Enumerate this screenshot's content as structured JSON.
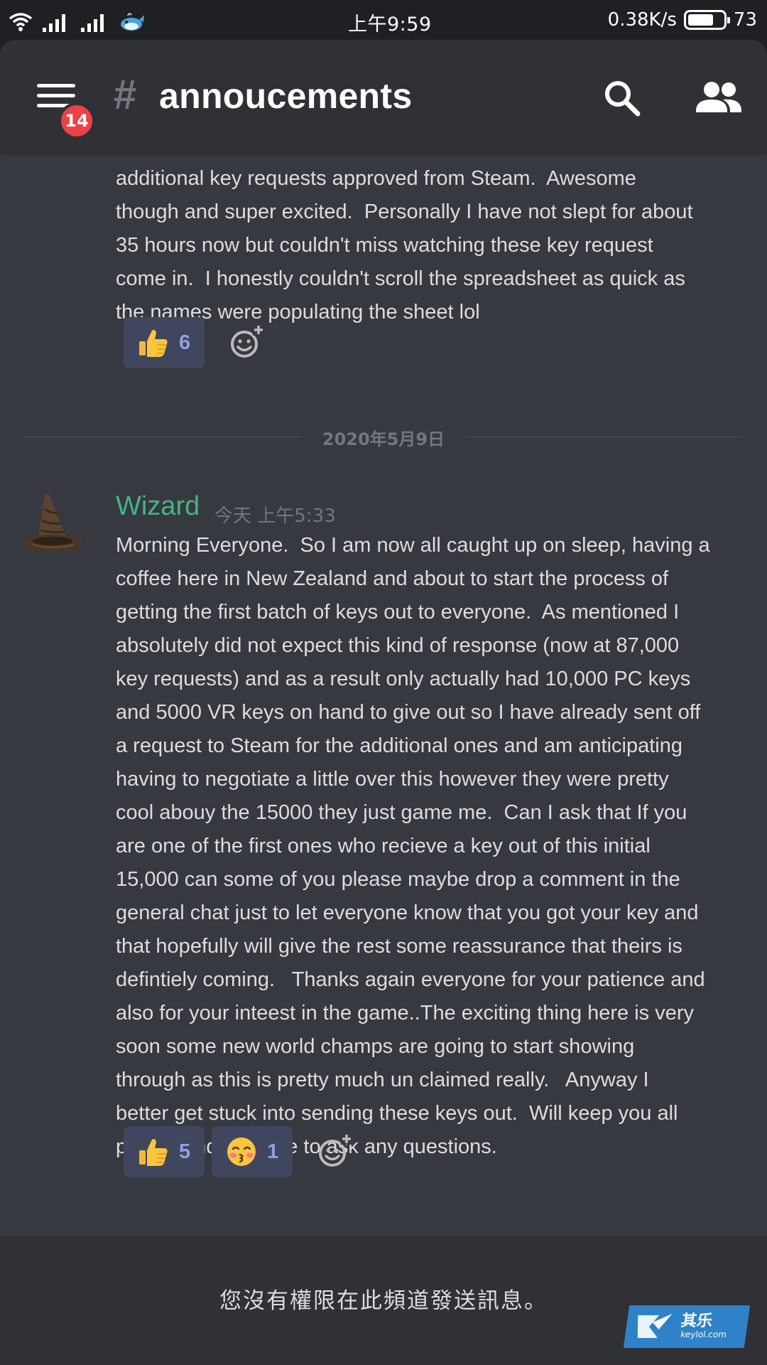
{
  "status_bar": {
    "time": "上午9:59",
    "net_speed": "0.38K/s",
    "battery_percent": "73",
    "battery_level": 0.73,
    "icons": [
      "wifi-icon",
      "signal-icon",
      "signal-icon",
      "app-icon"
    ]
  },
  "header": {
    "menu_icon": "menu-icon",
    "badge": "14",
    "hash": "#",
    "channel": "annoucements",
    "search_icon": "search-icon",
    "members_icon": "members-icon"
  },
  "message1": {
    "text": "additional key requests approved from Steam.  Awesome\nthough and super excited.  Personally I have not slept for about\n35 hours now but couldn't miss watching these key request\ncome in.  I honestly couldn't scroll the spreadsheet as quick as\nthe names were populating the sheet lol",
    "reactions": [
      {
        "emoji": "thumbs-up-emoji",
        "count": "6"
      }
    ]
  },
  "date_divider": "2020年5月9日",
  "message2": {
    "author": "Wizard",
    "timestamp": "今天 上午5:33",
    "text": "Morning Everyone.  So I am now all caught up on sleep, having a\ncoffee here in New Zealand and about to start the process of\ngetting the first batch of keys out to everyone.  As mentioned I\nabsolutely did not expect this kind of response (now at 87,000\nkey requests) and as a result only actually had 10,000 PC keys\nand 5000 VR keys on hand to give out so I have already sent off\na request to Steam for the additional ones and am anticipating\nhaving to negotiate a little over this however they were pretty\ncool abouy the 15000 they just game me.  Can I ask that If you\nare one of the first ones who recieve a key out of this initial\n15,000 can some of you please maybe drop a comment in the\ngeneral chat just to let everyone know that you got your key and\nthat hopefully will give the rest some reassurance that theirs is\ndefintiely coming.   Thanks again everyone for your patience and\nalso for your inteest in the game..The exciting thing here is very\nsoon some new world champs are going to start showing\nthrough as this is pretty much un claimed really.   Anyway I\nbetter get stuck into sending these keys out.  Will keep you all\nposted and feel free to ask any questions.",
    "reactions": [
      {
        "emoji": "thumbs-up-emoji",
        "count": "5"
      },
      {
        "emoji": "kissing-face-emoji",
        "count": "1"
      }
    ]
  },
  "footer": {
    "notice": "您沒有權限在此頻道發送訊息。"
  },
  "watermark": {
    "cn": "其乐",
    "en": "keylol.com"
  },
  "colors": {
    "background": "#36393f",
    "header": "#2f3136",
    "author": "#43b581",
    "badge": "#ed4245",
    "reaction_bg": "#40465e",
    "reaction_count": "#8ea1e1"
  }
}
